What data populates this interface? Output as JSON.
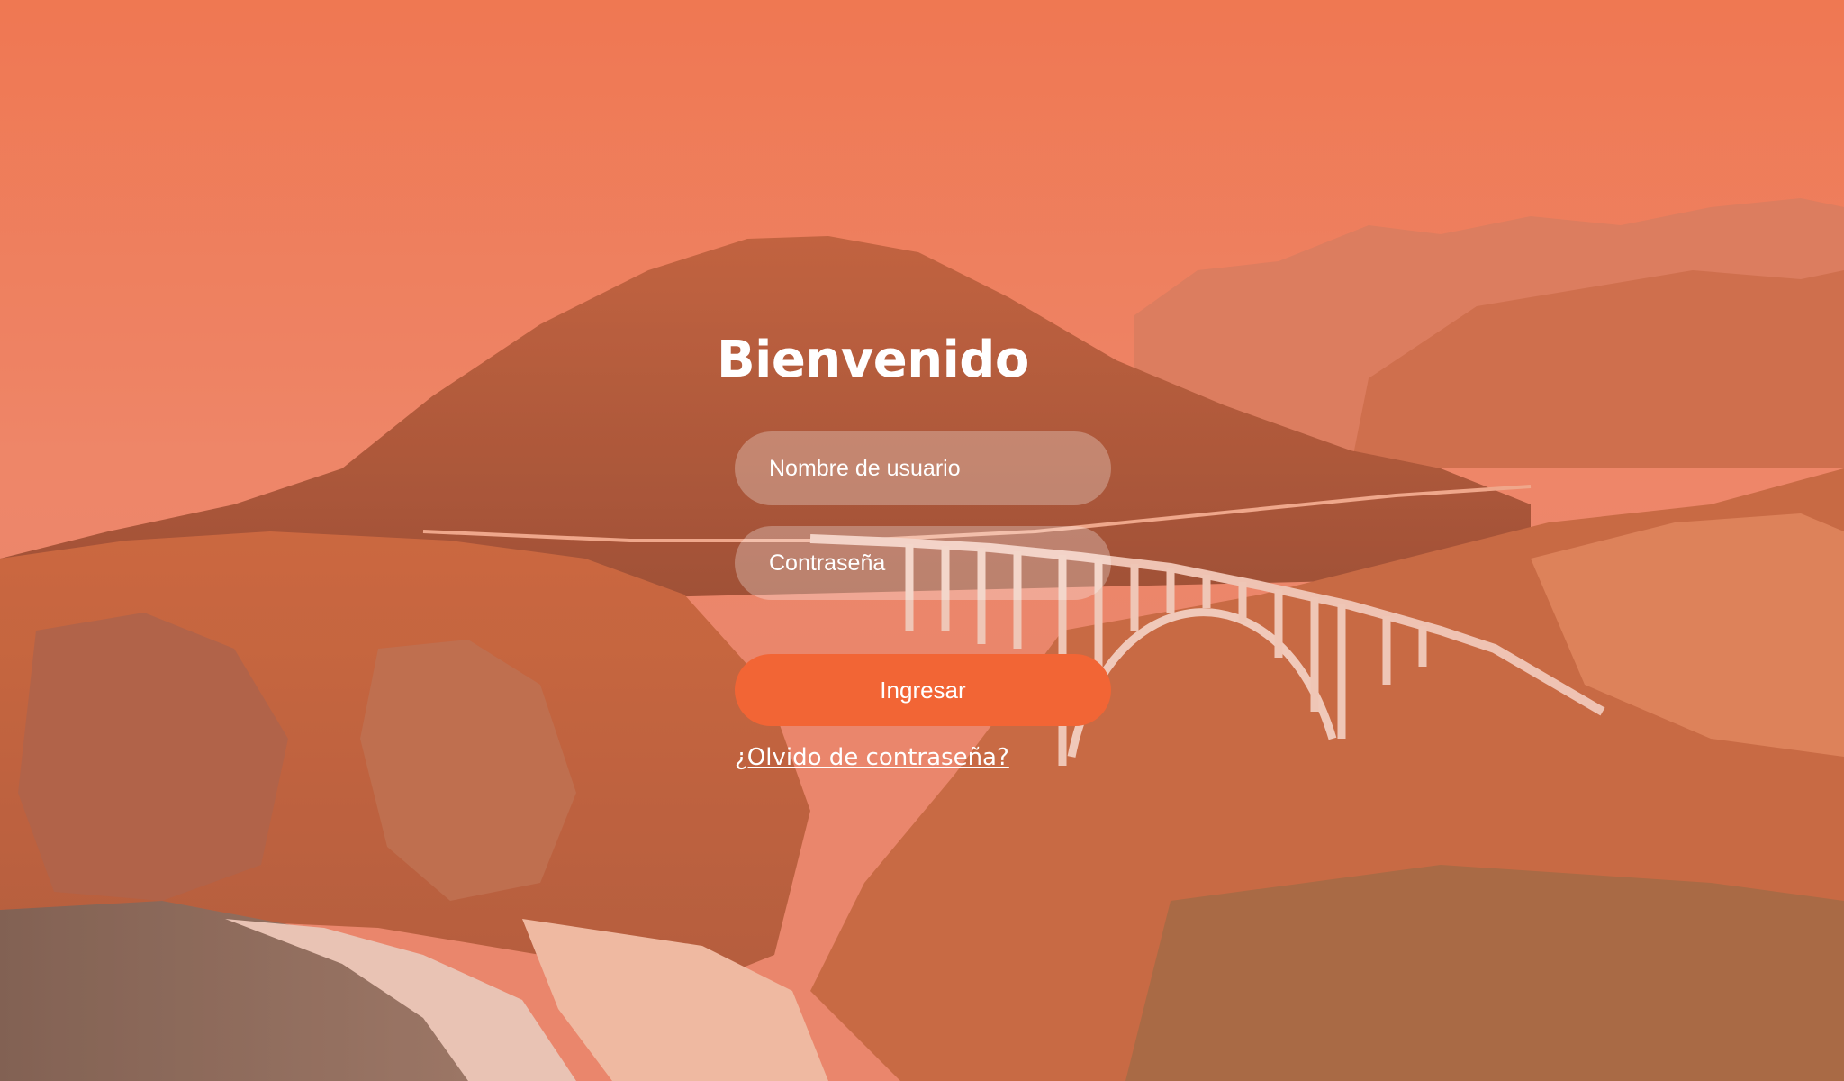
{
  "login": {
    "title": "Bienvenido",
    "username_placeholder": "Nombre de usuario",
    "username_value": "",
    "password_placeholder": "Contraseña",
    "password_value": "",
    "submit_label": "Ingresar",
    "forgot_label": "¿Olvido de contraseña?"
  },
  "colors": {
    "accent": "#f26535",
    "tint": "#ef7a55",
    "text": "#ffffff"
  }
}
